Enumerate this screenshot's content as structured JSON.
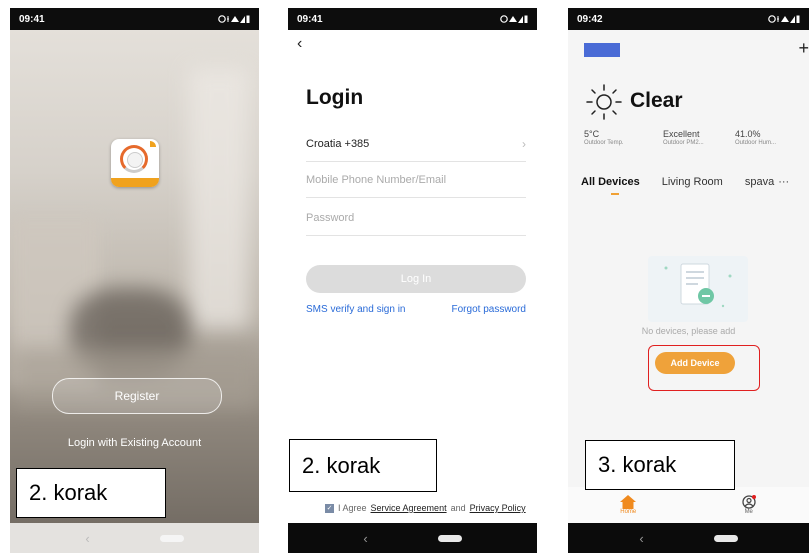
{
  "phone1": {
    "time": "09:41",
    "register_label": "Register",
    "existing_label": "Login with Existing Account",
    "step_label": "2. korak"
  },
  "phone2": {
    "time": "09:41",
    "title": "Login",
    "country": "Croatia +385",
    "phone_placeholder": "Mobile Phone Number/Email",
    "password_placeholder": "Password",
    "login_label": "Log In",
    "sms_label": "SMS verify and sign in",
    "forgot_label": "Forgot password",
    "step_label": "2. korak",
    "agree_prefix": "I Agree",
    "service_agreement": "Service Agreement",
    "and": "and",
    "privacy_policy": "Privacy Policy"
  },
  "phone3": {
    "time": "09:42",
    "weather": "Clear",
    "stats": [
      {
        "value": "5°C",
        "label": "Outdoor Temp."
      },
      {
        "value": "Excellent",
        "label": "Outdoor PM2..."
      },
      {
        "value": "41.0%",
        "label": "Outdoor Hum..."
      }
    ],
    "tabs": [
      "All Devices",
      "Living Room",
      "spava"
    ],
    "more": "···",
    "empty_text": "No devices, please add",
    "add_device": "Add Device",
    "step_label": "3. korak",
    "tab_home": "Home",
    "tab_me": "Me"
  },
  "colors": {
    "accent": "#efa23a",
    "link": "#2a6bd8",
    "highlight": "#e02020",
    "home_selector": "#4a6bd6"
  }
}
